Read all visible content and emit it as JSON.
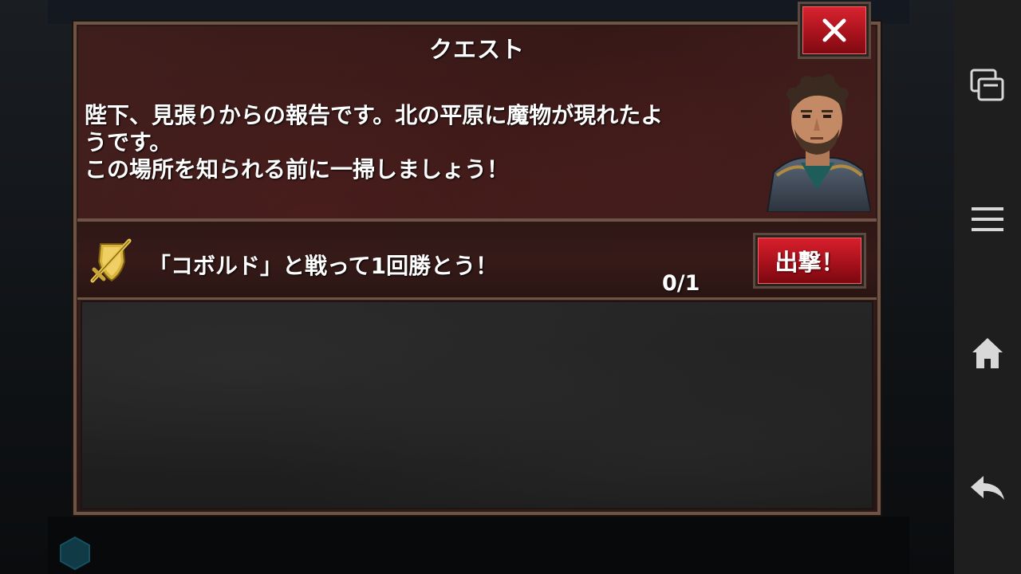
{
  "dialog": {
    "title": "クエスト",
    "message": "陛下、見張りからの報告です。北の平原に魔物が現れたよ\nうです。\nこの場所を知られる前に一掃しましょう！",
    "close_icon": "close-icon"
  },
  "quest_objective": {
    "text": "「コボルド」と戦って1回勝とう！",
    "progress": "0/1",
    "icon": "crossed-swords-shield-icon",
    "sortie_label": "出撃！"
  },
  "nav_bar": {
    "icons": [
      "recent-apps-icon",
      "menu-icon",
      "home-icon",
      "back-icon"
    ]
  },
  "colors": {
    "accent_red": "#c8161f",
    "dialog_border": "#6e5446",
    "dialog_bg": "#2e1715"
  }
}
